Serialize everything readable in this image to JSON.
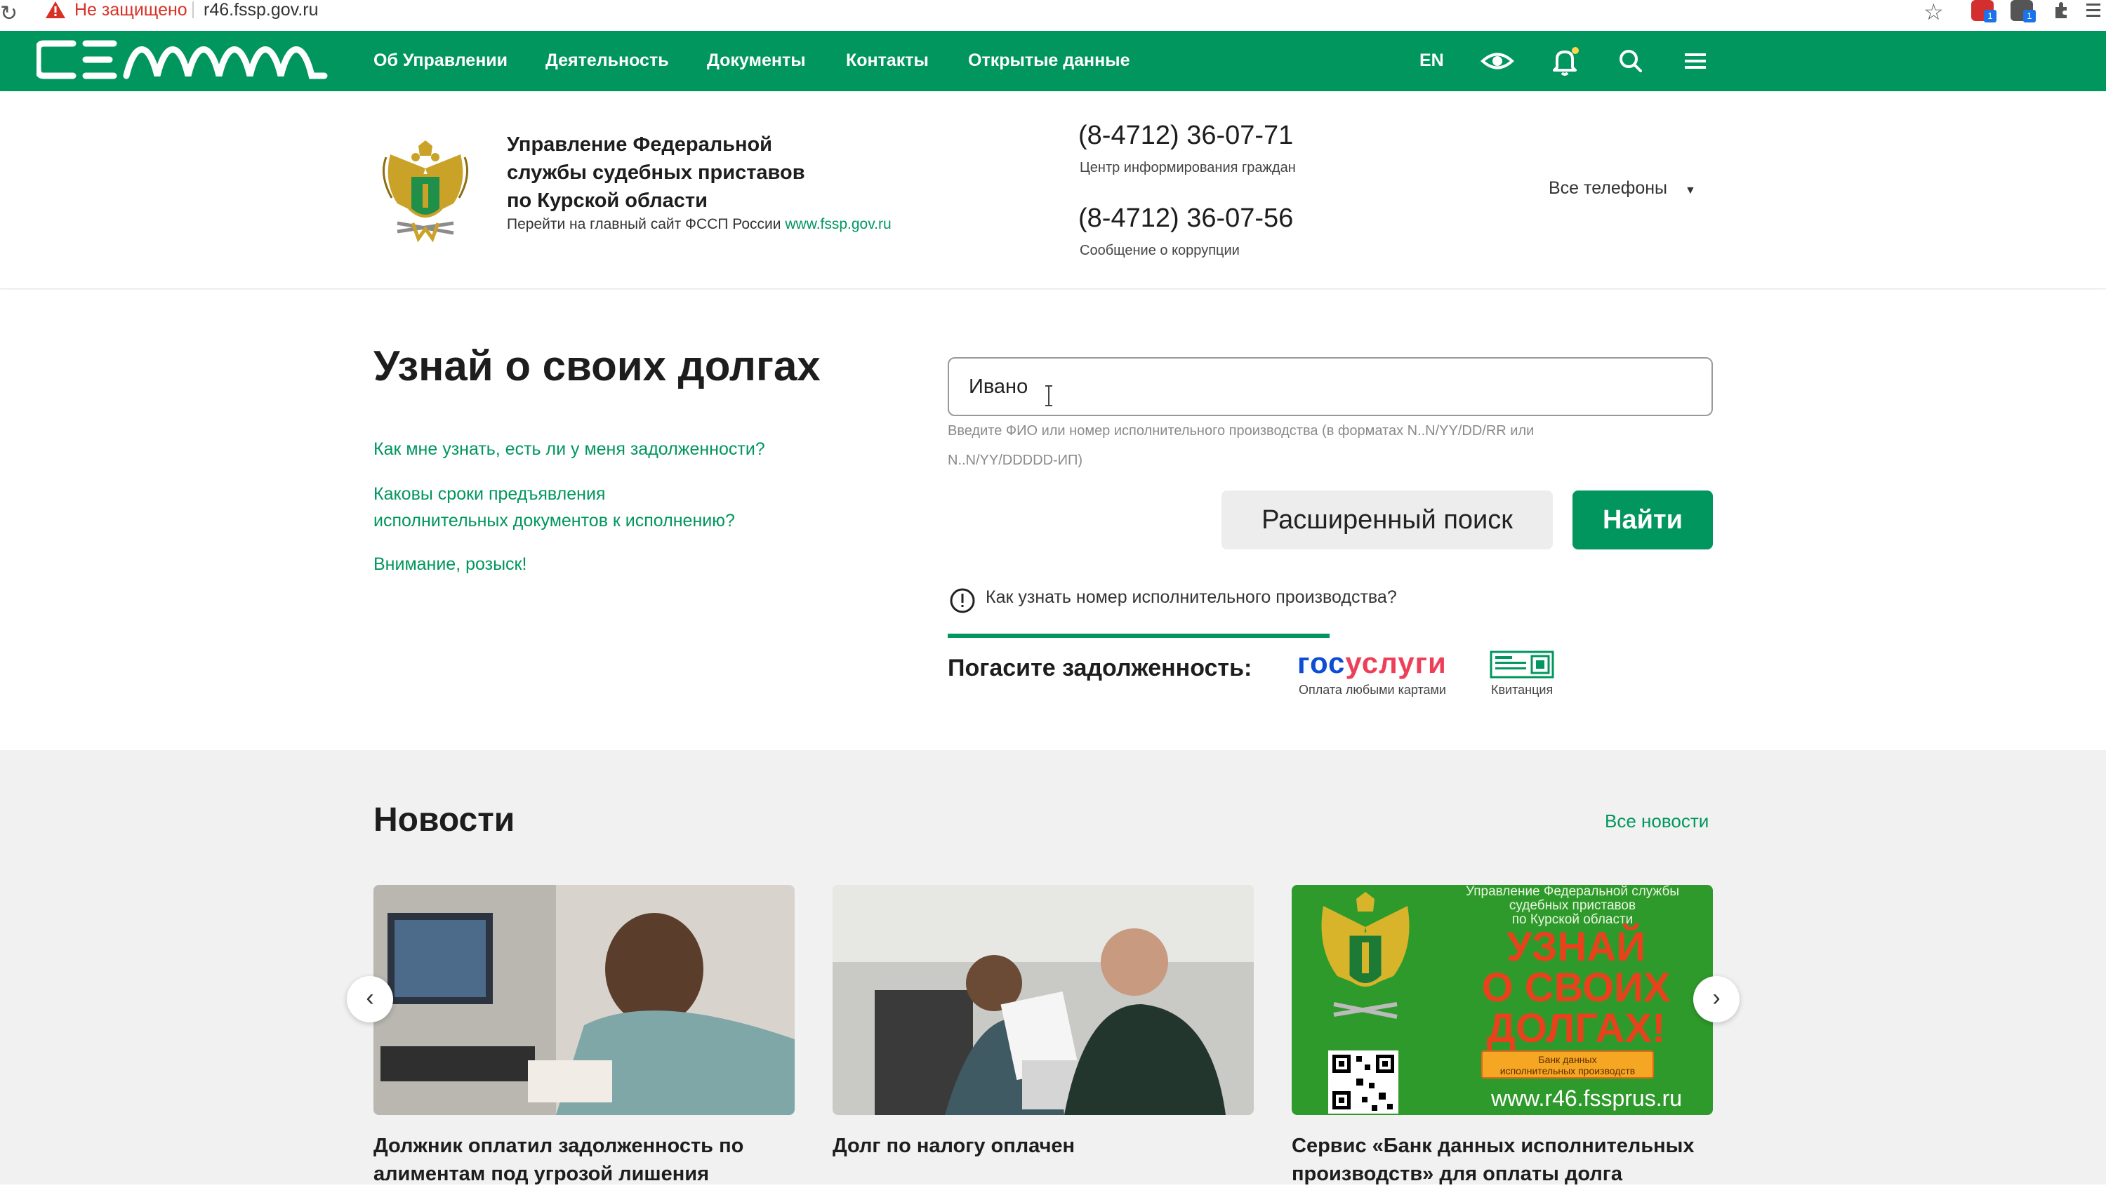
{
  "browser": {
    "insecure_label": "Не защищено",
    "url": "r46.fssp.gov.ru"
  },
  "nav": {
    "logo_text": "СЕМИ",
    "items": [
      "Об Управлении",
      "Деятельность",
      "Документы",
      "Контакты",
      "Открытые данные"
    ],
    "lang": "EN"
  },
  "header": {
    "org_name_line1": "Управление Федеральной",
    "org_name_line2": "службы судебных приставов",
    "org_name_line3": "по Курской области",
    "main_site_prefix": "Перейти на главный сайт ФССП России",
    "main_site_link": "www.fssp.gov.ru",
    "phone1": "(8-4712) 36-07-71",
    "phone1_note": "Центр информирования граждан",
    "phone2": "(8-4712) 36-07-56",
    "phone2_note": "Сообщение о коррупции",
    "all_phones": "Все телефоны"
  },
  "search": {
    "title": "Узнай о своих долгах",
    "faq": [
      "Как мне узнать, есть ли у меня задолженности?",
      "Каковы сроки предъявления",
      "исполнительных документов к исполнению?",
      "Внимание, розыск!"
    ],
    "input_value": "Ивано",
    "hint_line1": "Введите ФИО или номер исполнительного производства (в форматах N..N/YY/DD/RR или",
    "hint_line2": "N..N/YY/DDDDD-ИП)",
    "advanced_label": "Расширенный поиск",
    "find_label": "Найти",
    "info_link": "Как узнать номер исполнительного производства?",
    "pay_label": "Погасите задолженность:",
    "gos_part1": "гос",
    "gos_part2": "услуги",
    "gos_sub": "Оплата любыми картами",
    "kvit_label": "Квитанция"
  },
  "news": {
    "title": "Новости",
    "all_label": "Все новости",
    "cards": [
      {
        "line1": "Должник оплатил задолженность по",
        "line2": "алиментам под угрозой лишения"
      },
      {
        "line1": "Долг по налогу оплачен",
        "line2": ""
      },
      {
        "line1": "Сервис «Банк данных исполнительных",
        "line2": "производств» для оплаты долга"
      }
    ],
    "promo": {
      "top1": "Управление Федеральной службы",
      "top2": "судебных приставов",
      "top3": "по Курской области",
      "big1": "УЗНАЙ",
      "big2": "О СВОИХ",
      "big3": "ДОЛГАХ!",
      "badge1": "Банк данных",
      "badge2": "исполнительных производств",
      "url": "www.r46.fssprus.ru"
    }
  },
  "colors": {
    "brand_green": "#00965e",
    "gos_blue": "#0d4cd3",
    "gos_red": "#ee3f58"
  }
}
